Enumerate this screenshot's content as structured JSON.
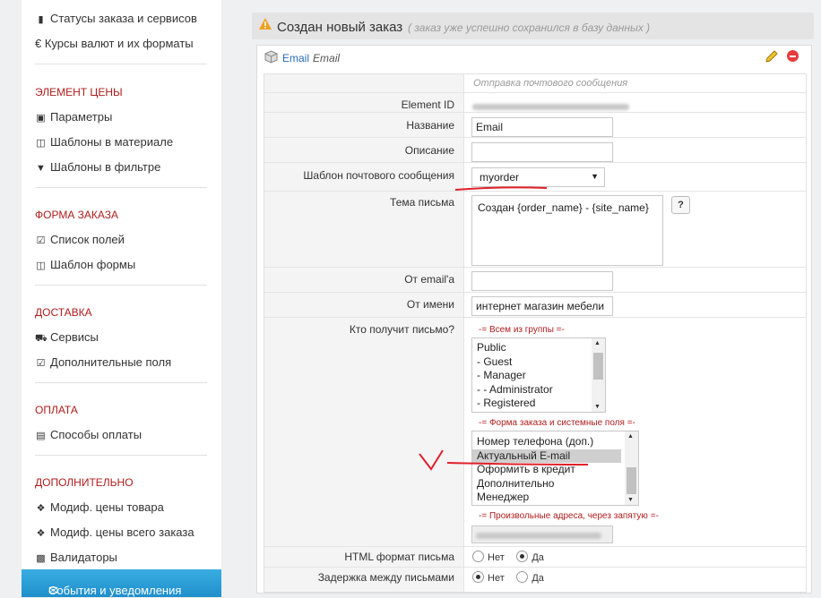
{
  "sidebar": {
    "top_items": [
      {
        "icon": "bookmark-icon",
        "label": "Статусы заказа и сервисов"
      },
      {
        "icon": "euro-icon",
        "label": "€ Курсы валют и их форматы"
      }
    ],
    "sections": [
      {
        "title": "ЭЛЕМЕНТ ЦЕНЫ",
        "items": [
          {
            "icon": "money-icon",
            "label": "Параметры"
          },
          {
            "icon": "columns-icon",
            "label": "Шаблоны в материале"
          },
          {
            "icon": "filter-icon",
            "label": "Шаблоны в фильтре"
          }
        ]
      },
      {
        "title": "ФОРМА ЗАКАЗА",
        "items": [
          {
            "icon": "checkbox-icon",
            "label": "Список полей"
          },
          {
            "icon": "columns-icon",
            "label": "Шаблон формы"
          }
        ]
      },
      {
        "title": "ДОСТАВКА",
        "items": [
          {
            "icon": "truck-icon",
            "label": "Сервисы"
          },
          {
            "icon": "checkbox-icon",
            "label": "Дополнительные поля"
          }
        ]
      },
      {
        "title": "ОПЛАТА",
        "items": [
          {
            "icon": "credit-card-icon",
            "label": "Способы оплаты"
          }
        ]
      },
      {
        "title": "ДОПОЛНИТЕЛЬНО",
        "items": [
          {
            "icon": "cubes-icon",
            "label": "Модиф. цены товара"
          },
          {
            "icon": "cubes-icon",
            "label": "Модиф. цены всего заказа"
          },
          {
            "icon": "cube-icon",
            "label": "Валидаторы"
          },
          {
            "icon": "envelope-icon",
            "label": "События и уведомления"
          }
        ]
      }
    ]
  },
  "header": {
    "icon": "warning-icon",
    "title": "Создан новый заказ",
    "subtitle": "( заказ уже успешно сохранился в базу данных )"
  },
  "panel": {
    "icon": "cube-icon",
    "title": "Email",
    "title_italic": "Email",
    "edit_icon": "pencil-icon",
    "remove_icon": "minus-circle-icon"
  },
  "form": {
    "heading": "Отправка почтового сообщения",
    "element_id_label": "Element ID",
    "name_label": "Название",
    "name_value": "Email",
    "description_label": "Описание",
    "description_value": "",
    "template_label": "Шаблон почтового сообщения",
    "template_value": "myorder",
    "subject_label": "Тема письма",
    "subject_value": "Создан {order_name} - {site_name}",
    "help_button": "?",
    "from_email_label": "От email'а",
    "from_email_value": "",
    "from_name_label": "От имени",
    "from_name_value": "интернет магазин мебели",
    "recipients_label": "Кто получит письмо?",
    "groups_caption": "-= Всем из группы =-",
    "groups": [
      "Public",
      "- Guest",
      "- Manager",
      "- - Administrator",
      "- Registered"
    ],
    "fields_caption": "-= Форма заказа и системные поля =-",
    "fields": [
      "Номер телефона (доп.)",
      "Актуальный E-mail",
      "Оформить в кредит",
      "Дополнительно",
      "Менеджер"
    ],
    "fields_selected": "Актуальный E-mail",
    "custom_caption": "-= Произвольные адреса, через запятую =-",
    "html_label": "HTML формат письма",
    "delay_label": "Задержка между письмами",
    "no": "Нет",
    "yes": "Да",
    "html_value": "Да",
    "delay_value": "Нет",
    "annotation_color": "#e0202a"
  }
}
